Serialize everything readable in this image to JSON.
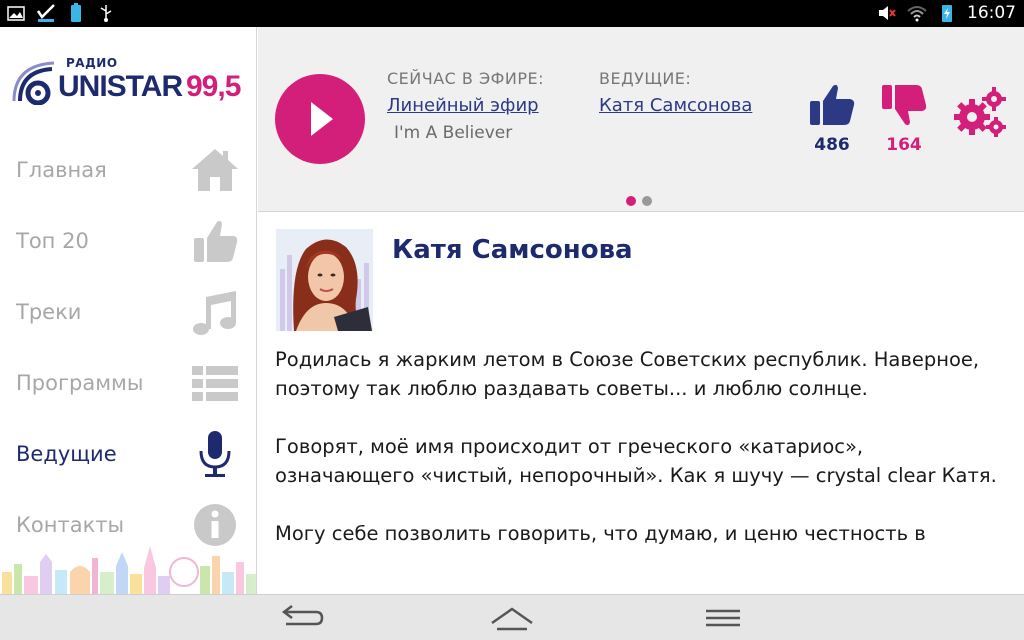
{
  "status_bar": {
    "time": "16:07",
    "icons_left": [
      "image-notification-icon",
      "check-notification-icon",
      "battery-app-icon",
      "usb-icon"
    ],
    "icons_right": [
      "muted-volume-icon",
      "wifi-icon",
      "battery-charging-icon"
    ]
  },
  "app": {
    "logo": {
      "prefix": "РАДИО",
      "name": "UNISTAR",
      "frequency": "99,5"
    },
    "nav": [
      {
        "label": "Главная",
        "icon": "home-icon",
        "active": false
      },
      {
        "label": "Топ 20",
        "icon": "thumbs-up-icon",
        "active": false
      },
      {
        "label": "Треки",
        "icon": "music-note-icon",
        "active": false
      },
      {
        "label": "Программы",
        "icon": "list-icon",
        "active": false
      },
      {
        "label": "Ведущие",
        "icon": "microphone-icon",
        "active": true
      },
      {
        "label": "Контакты",
        "icon": "info-icon",
        "active": false
      }
    ]
  },
  "player": {
    "now_playing_heading": "СЕЙЧАС В ЭФИРЕ:",
    "now_playing_link": "Линейный эфир",
    "now_playing_track": "I'm A Believer",
    "host_heading": "ВЕДУЩИЕ:",
    "host_link": "Катя Самсонова",
    "likes": "486",
    "dislikes": "164",
    "pager": {
      "pages": 2,
      "active": 0
    }
  },
  "host": {
    "name": "Катя Самсонова",
    "bio": [
      "Родилась я жарким летом в Союзе Советских республик. Наверное, поэтому так люблю раздавать советы... и люблю солнце.",
      "Говорят, моё имя происходит от греческого «катариос», означающего «чистый, непорочный». Как я шучу — crystal clear Катя.",
      "Могу себе позволить говорить, что думаю, и ценю честность в"
    ]
  },
  "colors": {
    "brand_navy": "#1d2a6e",
    "brand_pink": "#d41f7a",
    "inactive_grey": "#a7a7a7"
  },
  "system_nav": [
    "back-icon",
    "home-outline-icon",
    "menu-icon"
  ]
}
